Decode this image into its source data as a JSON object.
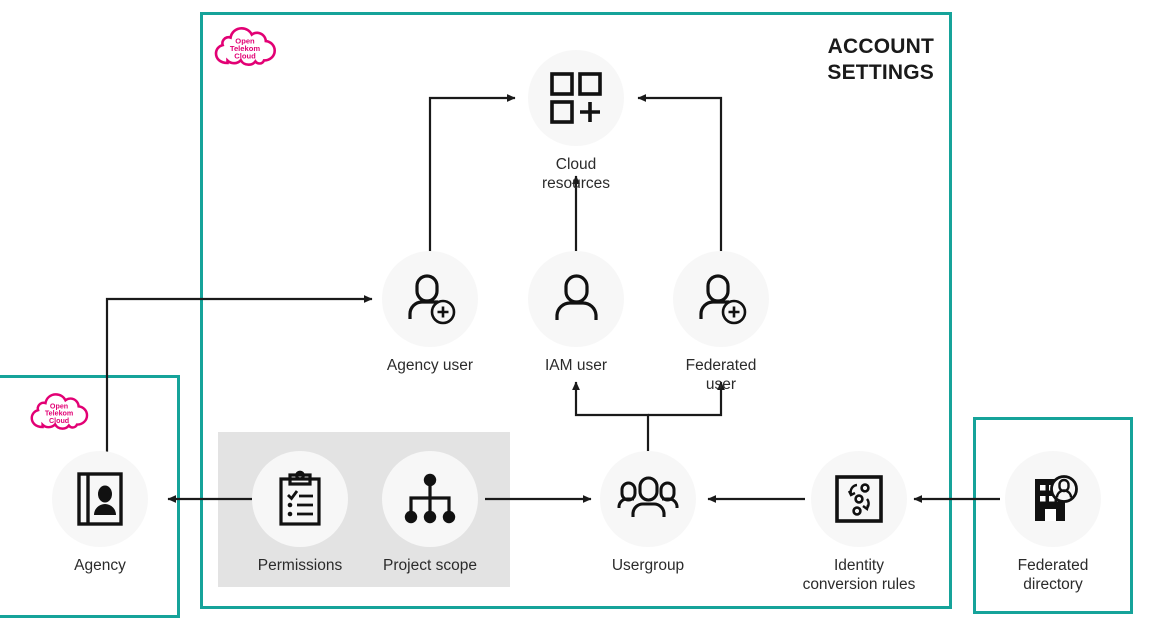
{
  "diagram": {
    "title_line1": "ACCOUNT",
    "title_line2": "SETTINGS",
    "title": "ACCOUNT\nSETTINGS",
    "colors": {
      "teal_border": "#16A39A",
      "magenta_logo": "#E20074",
      "gray_group_box": "#e3e3e3",
      "node_disc": "#f7f7f7",
      "ink": "#1a1a1a"
    },
    "brand_logo": {
      "name": "Open Telekom Cloud",
      "line1": "Open",
      "line2": "Telekom",
      "line3": "Cloud"
    },
    "containers": [
      {
        "id": "account-settings",
        "label": "ACCOUNT SETTINGS",
        "style": "teal-border"
      },
      {
        "id": "agency-container",
        "label": "",
        "style": "teal-border"
      },
      {
        "id": "federated-directory-container",
        "label": "",
        "style": "teal-border"
      },
      {
        "id": "permissions-scope-group",
        "label": "",
        "style": "gray-fill"
      }
    ],
    "nodes": [
      {
        "id": "cloud-resources",
        "label": "Cloud resources",
        "icon": "grid-plus-icon"
      },
      {
        "id": "agency-user",
        "label": "Agency user",
        "icon": "user-add-icon"
      },
      {
        "id": "iam-user",
        "label": "IAM user",
        "icon": "user-icon"
      },
      {
        "id": "federated-user",
        "label": "Federated user",
        "icon": "user-add-icon"
      },
      {
        "id": "agency",
        "label": "Agency",
        "icon": "id-card-icon"
      },
      {
        "id": "permissions",
        "label": "Permissions",
        "icon": "clipboard-check-icon"
      },
      {
        "id": "project-scope",
        "label": "Project scope",
        "icon": "hierarchy-icon"
      },
      {
        "id": "usergroup",
        "label": "Usergroup",
        "icon": "users-group-icon"
      },
      {
        "id": "identity-rules",
        "label": "Identity\nconversion rules",
        "icon": "conversion-rules-icon"
      },
      {
        "id": "federated-dir",
        "label": "Federated\ndirectory",
        "icon": "building-user-icon"
      }
    ],
    "edges": [
      {
        "from": "agency-user",
        "to": "cloud-resources",
        "arrow": "to"
      },
      {
        "from": "iam-user",
        "to": "cloud-resources",
        "arrow": "to"
      },
      {
        "from": "federated-user",
        "to": "cloud-resources",
        "arrow": "to"
      },
      {
        "from": "usergroup",
        "to": "iam-user",
        "arrow": "to"
      },
      {
        "from": "usergroup",
        "to": "federated-user",
        "arrow": "to"
      },
      {
        "from": "project-scope",
        "to": "usergroup",
        "arrow": "to"
      },
      {
        "from": "permissions",
        "to": "agency",
        "arrow": "to"
      },
      {
        "from": "agency",
        "to": "agency-user",
        "arrow": "to"
      },
      {
        "from": "identity-rules",
        "to": "usergroup",
        "arrow": "to"
      },
      {
        "from": "federated-dir",
        "to": "identity-rules",
        "arrow": "to"
      }
    ]
  }
}
